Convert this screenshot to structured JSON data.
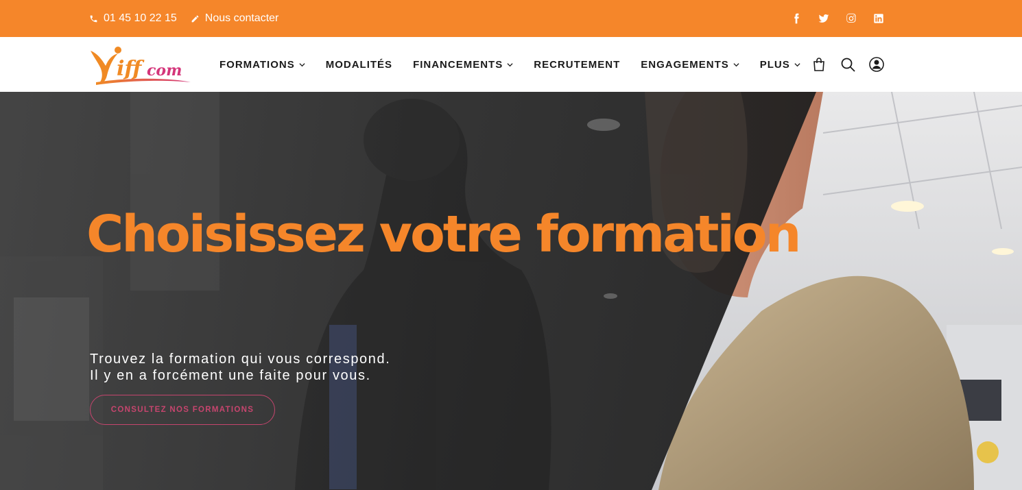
{
  "topbar": {
    "phone": "01 45 10 22 15",
    "contact_label": "Nous contacter",
    "social_icons": [
      "facebook-icon",
      "twitter-icon",
      "instagram-icon",
      "linkedin-icon"
    ],
    "background_color": "#f5862a"
  },
  "header": {
    "logo_text": "iffcom",
    "nav": [
      {
        "label": "FORMATIONS",
        "has_dropdown": true
      },
      {
        "label": "MODALITÉS",
        "has_dropdown": false
      },
      {
        "label": "FINANCEMENTS",
        "has_dropdown": true
      },
      {
        "label": "RECRUTEMENT",
        "has_dropdown": false
      },
      {
        "label": "ENGAGEMENTS",
        "has_dropdown": true
      },
      {
        "label": "PLUS",
        "has_dropdown": true
      }
    ],
    "tool_icons": [
      "shopping-bag-icon",
      "search-icon",
      "user-icon"
    ]
  },
  "hero": {
    "headline": "Choisissez votre formation",
    "subtitle_line1": "Trouvez la formation qui vous correspond.",
    "subtitle_line2": "Il y en a forcément une faite pour vous.",
    "cta_label": "CONSULTEZ NOS FORMATIONS",
    "accent_color": "#f5862a",
    "cta_color": "#c6456e"
  }
}
